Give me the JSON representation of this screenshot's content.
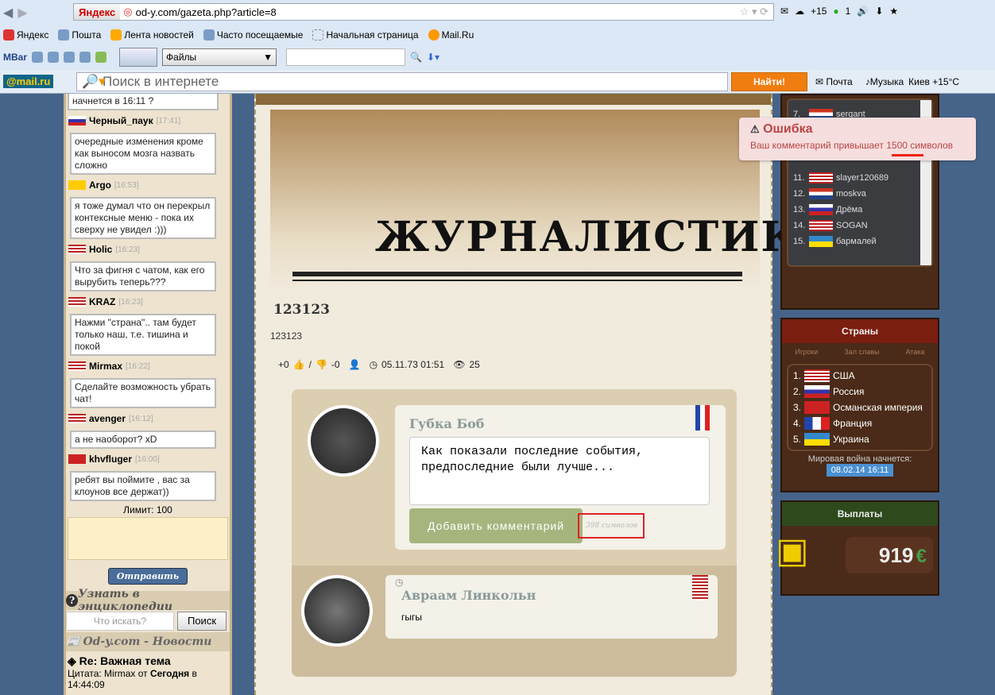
{
  "browser": {
    "yandex": "Яндекс",
    "url": "od-y.com/gazeta.php?article=8",
    "weather": "+15",
    "count": "1"
  },
  "bookmarks": [
    "Яндекс",
    "Пошта",
    "Лента новостей",
    "Часто посещаемые",
    "Начальная страница",
    "Mail.Ru"
  ],
  "mbar": {
    "label": "MBar",
    "files": "Файлы"
  },
  "mailru": {
    "logo": "@mail.ru",
    "placeholder": "Поиск в интернете",
    "find": "Найти!",
    "mail": "Почта",
    "music": "Музыка",
    "weather": "Киев +15°C"
  },
  "chat": {
    "first": "начнется в 16:11 ?",
    "messages": [
      {
        "user": "Черный_паук",
        "time": "[17:41]",
        "flag": "ru",
        "text": "очередные изменения кроме как выносом мозга назвать сложно"
      },
      {
        "user": "Argo",
        "time": "[16:53]",
        "flag": "ag",
        "text": "я тоже думал что он перекрыл контексные меню - пока их сверху не увидел :)))"
      },
      {
        "user": "Holic",
        "time": "[16:23]",
        "flag": "us",
        "text": "Что за фигня с чатом, как его вырубить теперь???"
      },
      {
        "user": "KRAZ",
        "time": "[16:23]",
        "flag": "us",
        "text": "Нажми \"страна\".. там будет только наш, т.е. тишина и покой"
      },
      {
        "user": "Mirmax",
        "time": "[16:22]",
        "flag": "us",
        "text": "Сделайте возможность убрать чат!"
      },
      {
        "user": "avenger",
        "time": "[16:12]",
        "flag": "us",
        "text": "а не наоборот? xD"
      },
      {
        "user": "khvfluger",
        "time": "[16:00]",
        "flag": "tr",
        "text": "ребят вы поймите , вас за клоунов все держат))"
      }
    ],
    "limit": "Лимит: 100",
    "send": "Отправить"
  },
  "encyclopedia": {
    "title": "Узнать в энциклопедии",
    "placeholder": "Что искать?",
    "search": "Поиск"
  },
  "news": {
    "title": "Od-y.com - Новости",
    "item_title": "Re: Важная тема",
    "item_text": "Цитата: Mirmax от ",
    "item_bold": "Сегодня",
    "item_rest": " в 14:44:09"
  },
  "article": {
    "section": "ЖУРНАЛИСТИКА",
    "title": "123123",
    "body": "123123",
    "likes": "+0",
    "sep": "/",
    "dislikes": "-0",
    "date": "05.11.73 01:51",
    "views": "25"
  },
  "comments": [
    {
      "author": "Губка Боб",
      "text": "Как показали последние события, предпоследние были лучше...",
      "button": "Добавить комментарий",
      "counter": "398 символов"
    },
    {
      "author": "Авраам Линкольн",
      "text": "гыгы"
    }
  ],
  "error": {
    "title": "Ошибка",
    "message": "Ваш комментарий привышает 1500 символов"
  },
  "rating": [
    {
      "n": "7.",
      "name": "sergant",
      "flag": "nl"
    },
    {
      "n": "11.",
      "name": "slayer120689",
      "flag": "us"
    },
    {
      "n": "12.",
      "name": "moskva",
      "flag": "nl"
    },
    {
      "n": "13.",
      "name": "Дрёма",
      "flag": "ru"
    },
    {
      "n": "14.",
      "name": "SOGAN",
      "flag": "us"
    },
    {
      "n": "15.",
      "name": "бармалей",
      "flag": "ua"
    }
  ],
  "countries": {
    "title": "Страны",
    "tabs": [
      "Игроки",
      "Зал славы",
      "Атака"
    ],
    "list": [
      {
        "n": "1.",
        "name": "США",
        "flag": "us"
      },
      {
        "n": "2.",
        "name": "Россия",
        "flag": "ru"
      },
      {
        "n": "3.",
        "name": "Османская империя",
        "flag": "tr"
      },
      {
        "n": "4.",
        "name": "Франция",
        "flag": "fr"
      },
      {
        "n": "5.",
        "name": "Украина",
        "flag": "ua"
      }
    ],
    "war_label": "Мировая война начнется:",
    "war_date": "08.02.14 16:11"
  },
  "payouts": {
    "title": "Выплаты",
    "amount": "919",
    "currency": "€"
  }
}
